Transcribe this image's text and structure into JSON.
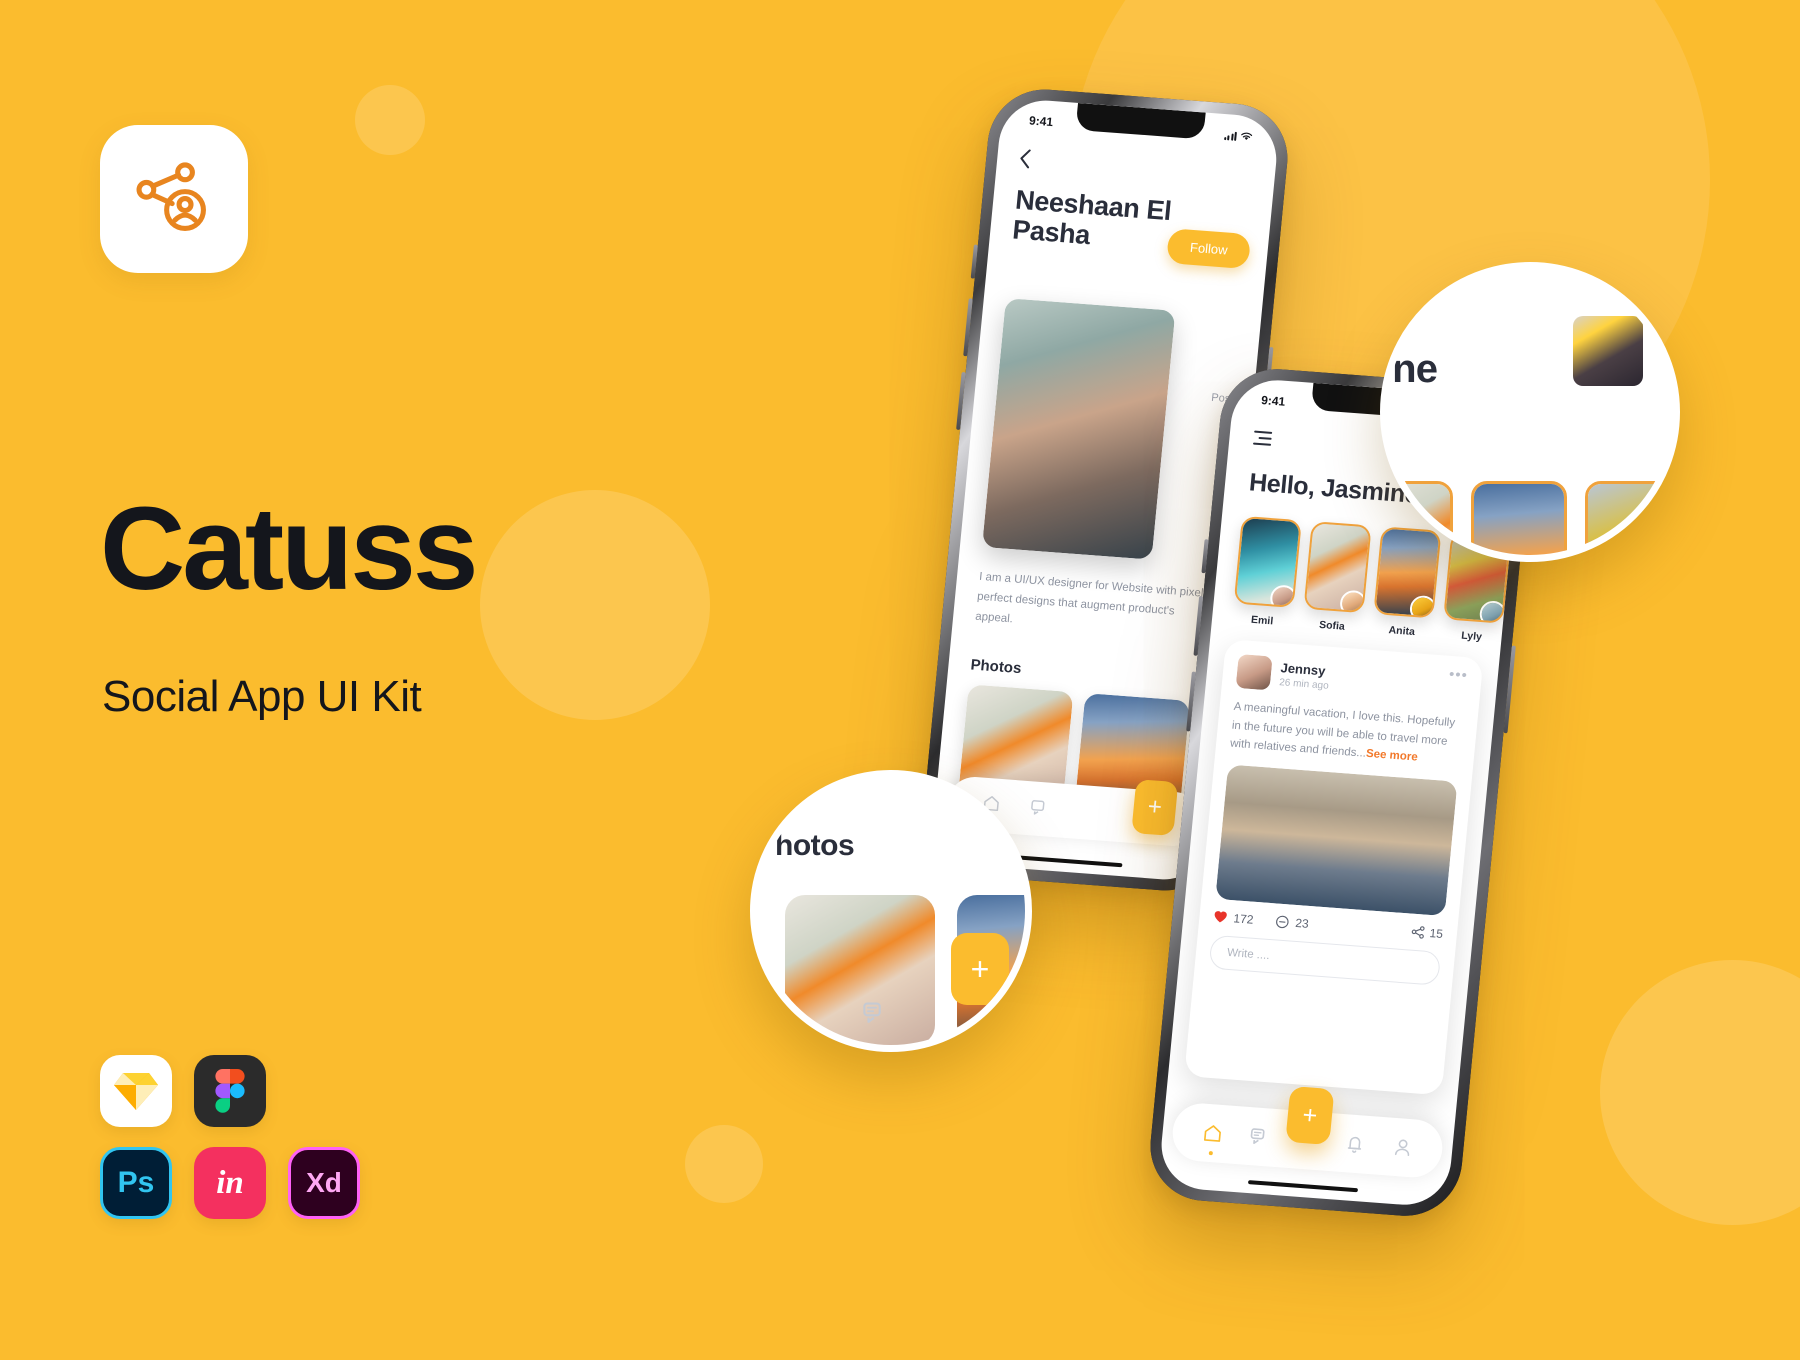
{
  "theme": {
    "background": "#FBBC2E",
    "accent": "#FBBC2E",
    "accent_orange": "#F2792B",
    "text_dark": "#14161C",
    "text_muted": "#8d93a0",
    "story_border": "#F0A23C"
  },
  "brand": {
    "icon_name": "share-person-icon",
    "title": "Catuss",
    "subtitle": "Social App UI Kit"
  },
  "tools": [
    {
      "name": "Sketch",
      "label": "",
      "icon": "sketch-icon"
    },
    {
      "name": "Figma",
      "label": "",
      "icon": "figma-icon"
    },
    {
      "name": "Photoshop",
      "label": "Ps",
      "icon": "photoshop-icon"
    },
    {
      "name": "InVision",
      "label": "in",
      "icon": "invision-icon"
    },
    {
      "name": "Adobe XD",
      "label": "Xd",
      "icon": "adobe-xd-icon"
    }
  ],
  "phone_profile": {
    "status": {
      "time": "9:41",
      "signal_icon": "signal-bars-icon",
      "wifi_icon": "wifi-icon"
    },
    "back_icon": "chevron-left-icon",
    "user_name": "Neeshaan El Pasha",
    "follow_label": "Follow",
    "post_label": "Post",
    "bio": "I am a UI/UX designer for Website with pixel perfect designs that augment product's appeal.",
    "photos_heading": "Photos",
    "nav": [
      {
        "name": "home",
        "icon": "home-icon"
      },
      {
        "name": "chat",
        "icon": "chat-icon"
      }
    ],
    "fab_label": "+"
  },
  "phone_feed": {
    "status": {
      "time": "9:41",
      "signal_icon": "signal-bars-icon",
      "wifi_icon": "wifi-icon"
    },
    "menu_icon": "hamburger-menu-icon",
    "greeting": "Hello, Jasmine",
    "stories": [
      {
        "name": "Emil",
        "photo": "ocean"
      },
      {
        "name": "Sofia",
        "photo": "flowers"
      },
      {
        "name": "Anita",
        "photo": "beachsun"
      },
      {
        "name": "Lyly",
        "photo": "balloons"
      }
    ],
    "post": {
      "more_icon": "more-options-icon",
      "author": "Jennsy",
      "time": "26 min ago",
      "body": "A meaningful vacation, I love this. Hopefully in the future you will be able to travel more with relatives and friends...",
      "see_more": "See more",
      "likes": "172",
      "comments": "23",
      "shares": "15",
      "like_icon": "heart-icon",
      "comment_icon": "comment-icon",
      "share_icon": "share-icon",
      "input_placeholder": "Write ...."
    },
    "nav": [
      {
        "name": "home",
        "icon": "home-icon",
        "active": true
      },
      {
        "name": "messages",
        "icon": "chat-icon",
        "active": false
      },
      {
        "name": "notifications",
        "icon": "bell-icon",
        "active": false
      },
      {
        "name": "profile",
        "icon": "user-icon",
        "active": false
      }
    ],
    "fab_label": "+"
  },
  "bubble_top": {
    "label": "mine",
    "avatar_icon": "profile-thumbnail"
  },
  "bubble_bottom": {
    "label": "hotos",
    "fab_label": "+",
    "chat_icon": "chat-icon"
  }
}
